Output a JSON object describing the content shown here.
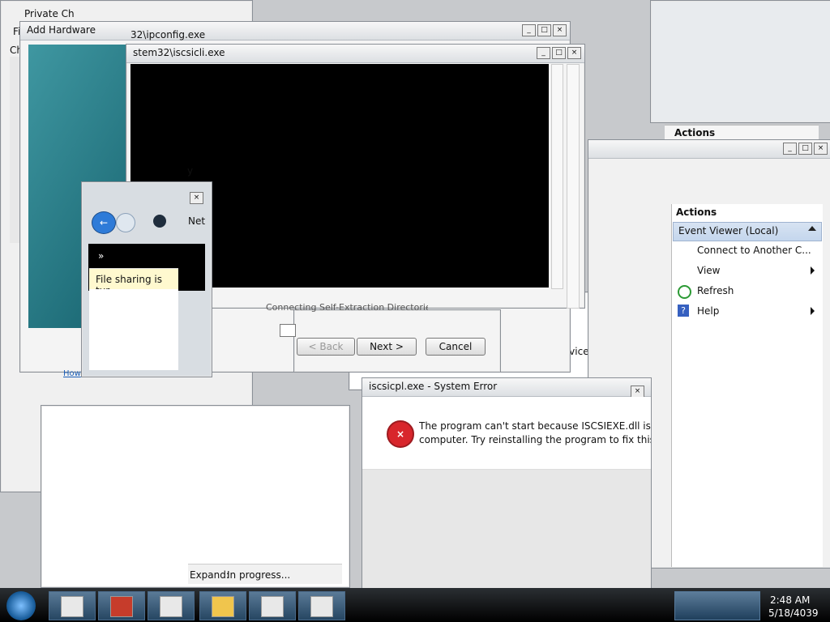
{
  "windows": {
    "private": {
      "title": "Private Ch",
      "menu_f": "Fi",
      "menu_ch": "Ch"
    },
    "add_hardware": {
      "title": "Add Hardware"
    },
    "ipconfig": {
      "title": "32\\ipconfig.exe"
    },
    "iscsicli": {
      "title": "stem32\\iscsicli.exe"
    },
    "fragment_y": "y",
    "network": {
      "address_text": "Net",
      "sidebar_marker": "»",
      "notice": "File sharing is tur...",
      "link_how": "How"
    },
    "wizard": {
      "back": "< Back",
      "next": "Next >",
      "cancel": "Cancel",
      "fragment_line": "Connecting Self-Extraction Directories"
    },
    "service_dialog": {
      "text": "y that the service is running."
    },
    "expand_status": {
      "label": "Expand:",
      "value": "In progress..."
    },
    "system_error": {
      "title": "iscsicpl.exe - System Error",
      "message_line1": "The program can't start because ISCSIEXE.dll is missir",
      "message_line2": "computer. Try reinstalling the program to fix this prol"
    },
    "event_viewer": {
      "actions_header": "Actions",
      "back_actions_header": "Actions",
      "group": "Event Viewer (Local)",
      "items": [
        {
          "label": "Connect to Another C...",
          "has_submenu": false
        },
        {
          "label": "View",
          "has_submenu": true
        },
        {
          "label": "Refresh",
          "has_submenu": false,
          "icon": "refresh-icon"
        },
        {
          "label": "Help",
          "has_submenu": true,
          "icon": "help-icon"
        }
      ]
    }
  },
  "taskbar": {
    "time": "2:48 AM",
    "date": "5/18/4039",
    "buttons": [
      "window-icon",
      "toolbox-icon",
      "window-icon",
      "add-folder-icon",
      "document-icon",
      "window-icon"
    ]
  },
  "colors": {
    "teal": "#1f6f7c",
    "titlebar": "#dcdfe3",
    "error_red": "#d8262c",
    "taskbar": "#1b1d20"
  }
}
